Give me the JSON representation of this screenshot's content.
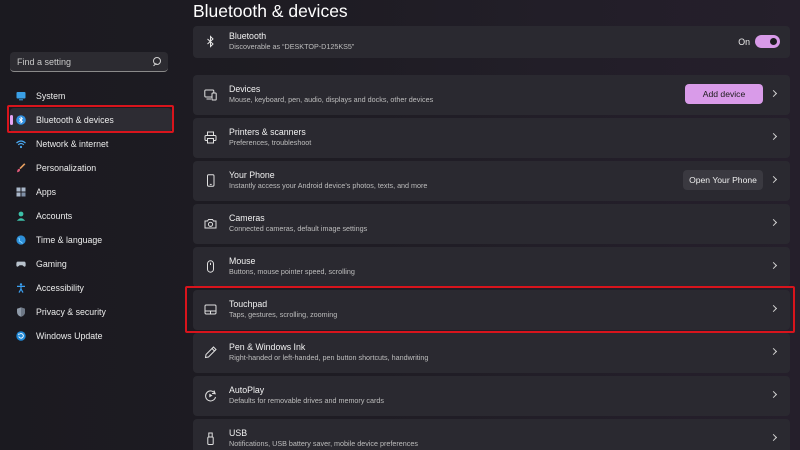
{
  "sidebar": {
    "search_placeholder": "Find a setting",
    "items": [
      {
        "label": "System",
        "icon": "monitor-icon"
      },
      {
        "label": "Bluetooth & devices",
        "icon": "bluetooth-icon",
        "active": true
      },
      {
        "label": "Network & internet",
        "icon": "wifi-icon"
      },
      {
        "label": "Personalization",
        "icon": "brush-icon"
      },
      {
        "label": "Apps",
        "icon": "apps-icon"
      },
      {
        "label": "Accounts",
        "icon": "person-icon"
      },
      {
        "label": "Time & language",
        "icon": "globe-icon"
      },
      {
        "label": "Gaming",
        "icon": "gamepad-icon"
      },
      {
        "label": "Accessibility",
        "icon": "accessibility-icon"
      },
      {
        "label": "Privacy & security",
        "icon": "shield-icon"
      },
      {
        "label": "Windows Update",
        "icon": "update-icon"
      }
    ]
  },
  "main": {
    "title": "Bluetooth & devices",
    "bluetooth": {
      "title": "Bluetooth",
      "subtitle": "Discoverable as “DESKTOP-D125KS5”",
      "toggle_label": "On",
      "toggle_on": true
    },
    "rows": [
      {
        "title": "Devices",
        "subtitle": "Mouse, keyboard, pen, audio, displays and docks, other devices",
        "button": "Add device",
        "icon": "devices-icon"
      },
      {
        "title": "Printers & scanners",
        "subtitle": "Preferences, troubleshoot",
        "icon": "printer-icon"
      },
      {
        "title": "Your Phone",
        "subtitle": "Instantly access your Android device’s photos, texts, and more",
        "button": "Open Your Phone",
        "icon": "phone-icon"
      },
      {
        "title": "Cameras",
        "subtitle": "Connected cameras, default image settings",
        "icon": "camera-icon"
      },
      {
        "title": "Mouse",
        "subtitle": "Buttons, mouse pointer speed, scrolling",
        "icon": "mouse-icon"
      },
      {
        "title": "Touchpad",
        "subtitle": "Taps, gestures, scrolling, zooming",
        "icon": "touchpad-icon"
      },
      {
        "title": "Pen & Windows Ink",
        "subtitle": "Right-handed or left-handed, pen button shortcuts, handwriting",
        "icon": "pen-icon"
      },
      {
        "title": "AutoPlay",
        "subtitle": "Defaults for removable drives and memory cards",
        "icon": "autoplay-icon"
      },
      {
        "title": "USB",
        "subtitle": "Notifications, USB battery saver, mobile device preferences",
        "icon": "usb-icon"
      }
    ]
  },
  "colors": {
    "accent": "#d99be9",
    "highlight": "#d8141c"
  }
}
